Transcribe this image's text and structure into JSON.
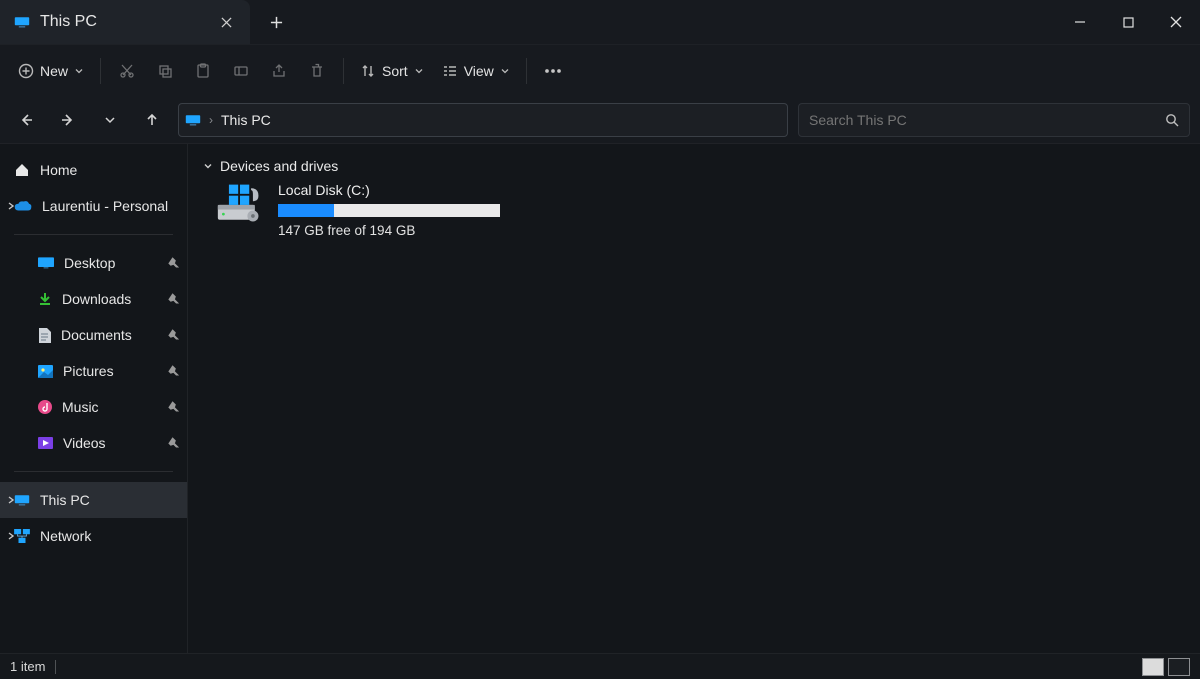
{
  "window": {
    "tab_title": "This PC"
  },
  "toolbar": {
    "new_label": "New",
    "sort_label": "Sort",
    "view_label": "View"
  },
  "address": {
    "crumb": "This PC"
  },
  "search": {
    "placeholder": "Search This PC"
  },
  "sidebar": {
    "home": "Home",
    "cloud": "Laurentiu - Personal",
    "pinned": [
      {
        "label": "Desktop"
      },
      {
        "label": "Downloads"
      },
      {
        "label": "Documents"
      },
      {
        "label": "Pictures"
      },
      {
        "label": "Music"
      },
      {
        "label": "Videos"
      }
    ],
    "thispc": "This PC",
    "network": "Network"
  },
  "content": {
    "group_header": "Devices and drives",
    "drive": {
      "name": "Local Disk (C:)",
      "free_text": "147 GB free of 194 GB",
      "used_pct": 25
    }
  },
  "status": {
    "items": "1 item"
  }
}
